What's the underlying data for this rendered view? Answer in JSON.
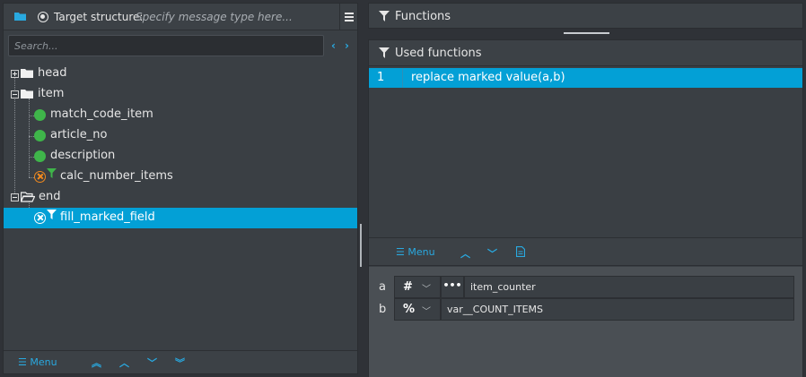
{
  "left_panel": {
    "header": {
      "label": "Target structure:",
      "placeholder": "Specify message type here..."
    },
    "search": {
      "placeholder": "Search..."
    },
    "tree": [
      {
        "label": "head",
        "kind": "folder",
        "expanded": false
      },
      {
        "label": "item",
        "kind": "folder",
        "expanded": true
      },
      {
        "label": "match_code_item",
        "kind": "field",
        "status": "green"
      },
      {
        "label": "article_no",
        "kind": "field",
        "status": "green"
      },
      {
        "label": "description",
        "kind": "field",
        "status": "green"
      },
      {
        "label": "calc_number_items",
        "kind": "function-field",
        "status": "orange"
      },
      {
        "label": "end",
        "kind": "folder",
        "expanded": true
      },
      {
        "label": "fill_marked_field",
        "kind": "function-field",
        "status": "selected"
      }
    ],
    "footer": {
      "menu_label": "Menu"
    }
  },
  "right_panel": {
    "functions_title": "Functions",
    "used_functions_title": "Used functions",
    "used_functions": [
      {
        "index": "1",
        "name": "replace marked value(a,b)"
      }
    ],
    "menu_label": "Menu",
    "params": [
      {
        "name": "a",
        "type_symbol": "#",
        "value": "item_counter",
        "has_dots": true
      },
      {
        "name": "b",
        "type_symbol": "%",
        "value": "var__COUNT_ITEMS",
        "has_dots": false
      }
    ]
  },
  "colors": {
    "accent": "#03a0d6",
    "link": "#29a9e0",
    "green": "#3fb54a",
    "orange": "#f28a1e",
    "panel": "#3a3f44"
  }
}
